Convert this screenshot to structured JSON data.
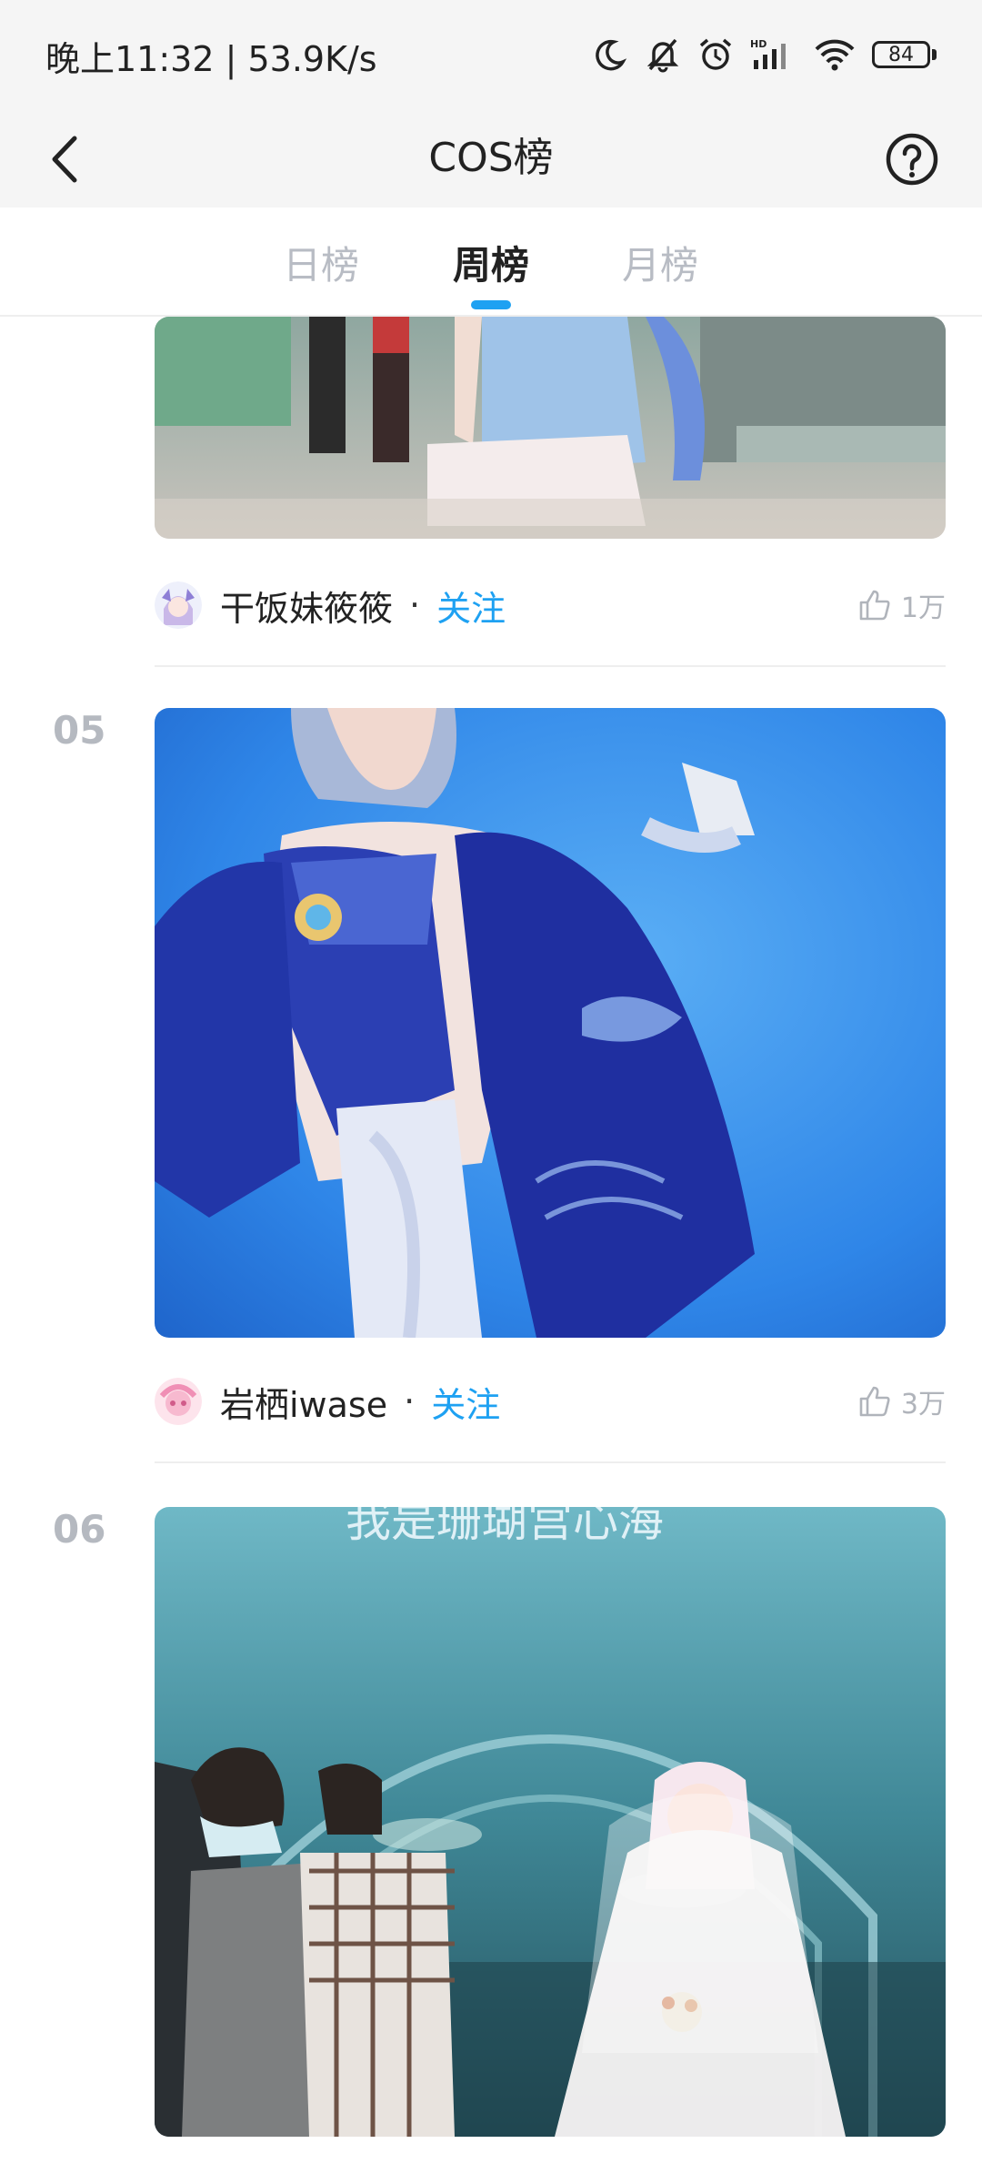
{
  "status_bar": {
    "time": "晚上11:32 | 53.9K/s",
    "battery": "84",
    "icons": [
      "moon-icon",
      "mute-bell-icon",
      "alarm-icon",
      "hd-signal-icon",
      "wifi-icon",
      "battery-icon"
    ]
  },
  "nav": {
    "title": "COS榜",
    "back_icon": "chevron-left-icon",
    "help_icon": "help-circle-icon"
  },
  "tabs": {
    "items": [
      {
        "label": "日榜",
        "active": false
      },
      {
        "label": "周榜",
        "active": true
      },
      {
        "label": "月榜",
        "active": false
      }
    ],
    "accent": "#1ea1f2"
  },
  "feed": [
    {
      "rank": "",
      "author": "干饭妹筱筱",
      "separator": "·",
      "follow_label": "关注",
      "likes": "1万"
    },
    {
      "rank": "05",
      "author": "岩栖iwase",
      "separator": "·",
      "follow_label": "关注",
      "likes": "3万"
    },
    {
      "rank": "06",
      "photo_caption": "我是珊瑚宫心海"
    }
  ]
}
